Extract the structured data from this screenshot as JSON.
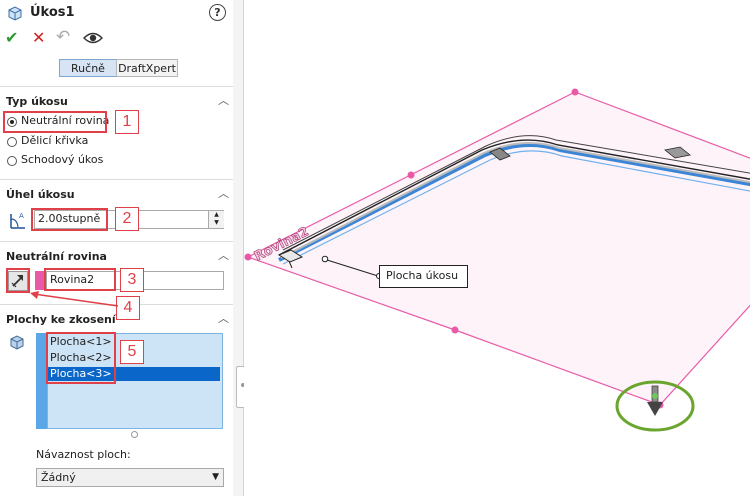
{
  "header": {
    "title": "Úkos1",
    "help_glyph": "?"
  },
  "toolbar": {
    "ok_glyph": "✔",
    "cancel_glyph": "✕",
    "undo_glyph": "↶",
    "preview_glyph": "👁"
  },
  "tabs": [
    {
      "label": "Ručně",
      "active": true
    },
    {
      "label": "DraftXpert",
      "active": false
    }
  ],
  "sections": {
    "draft_type": {
      "title": "Typ úkosu",
      "options": [
        {
          "label": "Neutrální rovina",
          "selected": true
        },
        {
          "label": "Dělicí křivka",
          "selected": false
        },
        {
          "label": "Schodový úkos",
          "selected": false
        }
      ]
    },
    "draft_angle": {
      "title": "Úhel úkosu",
      "value": "2.00stupně"
    },
    "neutral_plane": {
      "title": "Neutrální rovina",
      "value": "Rovina2"
    },
    "faces": {
      "title": "Plochy ke zkosení",
      "items": [
        {
          "label": "Plocha<1>",
          "selected": false
        },
        {
          "label": "Plocha<2>",
          "selected": false
        },
        {
          "label": "Plocha<3>",
          "selected": true
        }
      ],
      "propagation_label": "Návaznost ploch:",
      "propagation_value": "Žádný"
    }
  },
  "annotations": [
    "1",
    "2",
    "3",
    "4",
    "5"
  ],
  "viewport": {
    "plane_label": "Rovina2",
    "callout_label": "Plocha úkosu"
  },
  "colors": {
    "annotation_red": "#e04048",
    "plane_pink": "#e85aa8",
    "highlight_green": "#6aa52e",
    "selection_blue": "#0a66c8"
  }
}
